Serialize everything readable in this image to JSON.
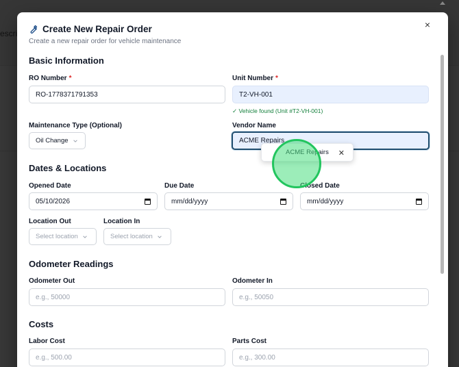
{
  "background": {
    "partial_text": "escrip"
  },
  "modal": {
    "title": "Create New Repair Order",
    "subtitle": "Create a new repair order for vehicle maintenance",
    "close_glyph": "×"
  },
  "basic": {
    "heading": "Basic Information",
    "ro_label": "RO Number",
    "ro_value": "RO-1778371791353",
    "unit_label": "Unit Number",
    "unit_value": "T2-VH-001",
    "unit_hint": "✓ Vehicle found (Unit #T2-VH-001)",
    "maint_label": "Maintenance Type (Optional)",
    "maint_value": "Oil Change",
    "vendor_label": "Vendor Name",
    "vendor_value": "ACME Repairs",
    "vendor_suggestion": "ACME Repairs",
    "required_mark": "*"
  },
  "dates": {
    "heading": "Dates & Locations",
    "opened_label": "Opened Date",
    "opened_value": "05/10/2026",
    "due_label": "Due Date",
    "due_value": "mm/dd/yyyy",
    "closed_label": "Closed Date",
    "closed_value": "mm/dd/yyyy",
    "loc_out_label": "Location Out",
    "loc_out_value": "Select location",
    "loc_in_label": "Location In",
    "loc_in_value": "Select location"
  },
  "odometer": {
    "heading": "Odometer Readings",
    "out_label": "Odometer Out",
    "out_placeholder": "e.g., 50000",
    "in_label": "Odometer In",
    "in_placeholder": "e.g., 50050"
  },
  "costs": {
    "heading": "Costs",
    "labor_label": "Labor Cost",
    "labor_placeholder": "e.g., 500.00",
    "parts_label": "Parts Cost",
    "parts_placeholder": "e.g., 300.00"
  },
  "icons": {
    "title_icon": "wrench-icon",
    "close": "close-icon",
    "calendar": "calendar-icon",
    "chevron": "chevron-down-icon"
  },
  "colors": {
    "focus_border": "#1f4d6e",
    "filled_bg": "#e8f0fe",
    "success_text": "#15803d",
    "required": "#dc2626",
    "cursor_highlight": "#22c55e"
  }
}
